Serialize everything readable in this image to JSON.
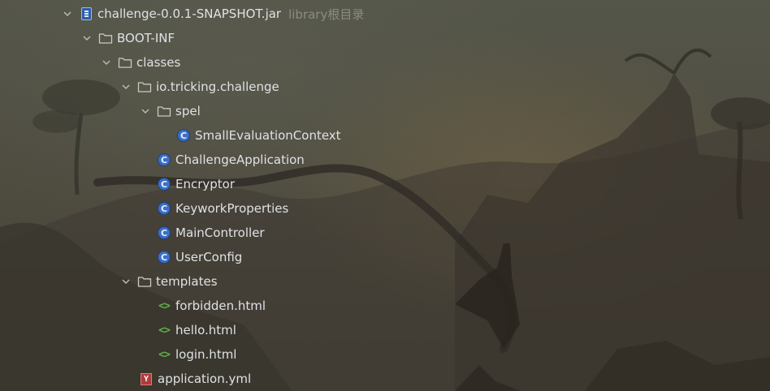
{
  "project_tree": {
    "root": {
      "label": "challenge-0.0.1-SNAPSHOT.jar",
      "hint": "library根目录",
      "icon": "jar-icon",
      "expanded": true
    },
    "nodes": [
      {
        "label": "BOOT-INF",
        "icon": "folder-icon",
        "expanded": true,
        "depth": 1
      },
      {
        "label": "classes",
        "icon": "folder-icon",
        "expanded": true,
        "depth": 2
      },
      {
        "label": "io.tricking.challenge",
        "icon": "folder-icon",
        "expanded": true,
        "depth": 3
      },
      {
        "label": "spel",
        "icon": "folder-icon",
        "expanded": true,
        "depth": 4
      },
      {
        "label": "SmallEvaluationContext",
        "icon": "class-icon",
        "depth": 5
      },
      {
        "label": "ChallengeApplication",
        "icon": "class-icon",
        "depth": 4
      },
      {
        "label": "Encryptor",
        "icon": "class-icon",
        "depth": 4
      },
      {
        "label": "KeyworkProperties",
        "icon": "class-icon",
        "depth": 4
      },
      {
        "label": "MainController",
        "icon": "class-icon",
        "depth": 4
      },
      {
        "label": "UserConfig",
        "icon": "class-icon",
        "depth": 4
      },
      {
        "label": "templates",
        "icon": "folder-icon",
        "expanded": true,
        "depth": 3
      },
      {
        "label": "forbidden.html",
        "icon": "html-file-icon",
        "depth": 4
      },
      {
        "label": "hello.html",
        "icon": "html-file-icon",
        "depth": 4
      },
      {
        "label": "login.html",
        "icon": "html-file-icon",
        "depth": 4
      },
      {
        "label": "application.yml",
        "icon": "yaml-file-icon",
        "depth": 3
      }
    ]
  },
  "glyphs": {
    "class_letter": "C",
    "yaml_letter": "Y",
    "html_symbol": "<>"
  },
  "colors": {
    "text": "#dfe1e5",
    "hint": "#8a8c84",
    "class_icon": "#3b6fc9",
    "html_icon": "#5fb04a",
    "yaml_icon": "#b23a3a"
  }
}
